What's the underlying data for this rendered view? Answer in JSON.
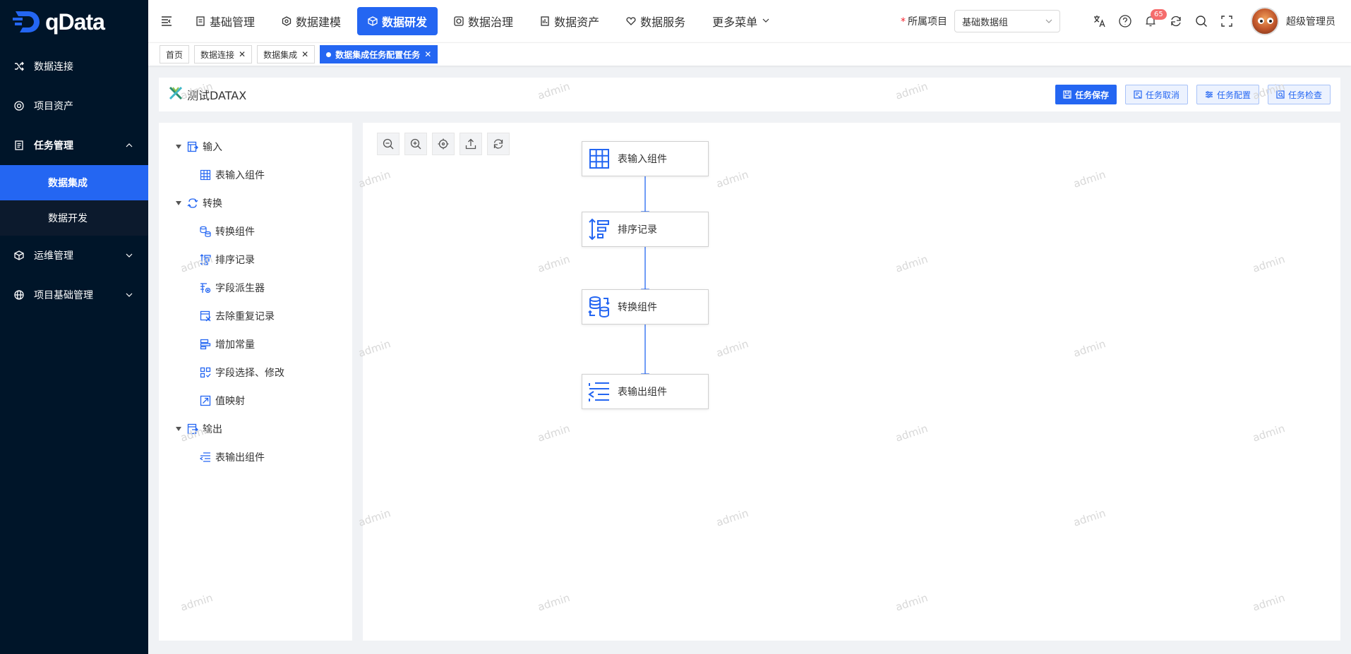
{
  "app": {
    "logo_text": "qData",
    "brand_color": "#2466f2",
    "sidebar_bg": "#001529"
  },
  "sidebar": {
    "items": [
      {
        "label": "数据连接",
        "icon": "shuffle-icon"
      },
      {
        "label": "项目资产",
        "icon": "asset-icon"
      },
      {
        "label": "任务管理",
        "icon": "document-icon",
        "expanded": true,
        "children": [
          {
            "label": "数据集成",
            "active": true
          },
          {
            "label": "数据开发"
          }
        ]
      },
      {
        "label": "运维管理",
        "icon": "cube-icon"
      },
      {
        "label": "项目基础管理",
        "icon": "globe-icon"
      }
    ]
  },
  "topnav": {
    "items": [
      {
        "label": "基础管理",
        "icon": "doc-icon"
      },
      {
        "label": "数据建模",
        "icon": "hexagon-icon"
      },
      {
        "label": "数据研发",
        "icon": "cube-icon",
        "active": true
      },
      {
        "label": "数据治理",
        "icon": "govern-icon"
      },
      {
        "label": "数据资产",
        "icon": "asset-doc-icon"
      },
      {
        "label": "数据服务",
        "icon": "heart-icon"
      },
      {
        "label": "更多菜单",
        "icon": "chevron-down-icon"
      }
    ],
    "project_label": "所属项目",
    "project_value": "基础数据组",
    "notification_count": "65",
    "username": "超级管理员"
  },
  "tabs": [
    {
      "label": "首页",
      "closable": false
    },
    {
      "label": "数据连接",
      "closable": true
    },
    {
      "label": "数据集成",
      "closable": true
    },
    {
      "label": "数据集成任务配置任务",
      "closable": true,
      "active": true
    }
  ],
  "header": {
    "title": "测试DATAX",
    "buttons": {
      "save": "任务保存",
      "cancel": "任务取消",
      "config": "任务配置",
      "check": "任务检查"
    }
  },
  "tree": {
    "groups": [
      {
        "label": "输入",
        "children": [
          "表输入组件"
        ]
      },
      {
        "label": "转换",
        "children": [
          "转换组件",
          "排序记录",
          "字段派生器",
          "去除重复记录",
          "增加常量",
          "字段选择、修改",
          "值映射"
        ]
      },
      {
        "label": "输出",
        "children": [
          "表输出组件"
        ]
      }
    ]
  },
  "canvas": {
    "nodes": [
      "表输入组件",
      "排序记录",
      "转换组件",
      "表输出组件"
    ],
    "edge_color": "#2466f2"
  },
  "watermark": "admin"
}
